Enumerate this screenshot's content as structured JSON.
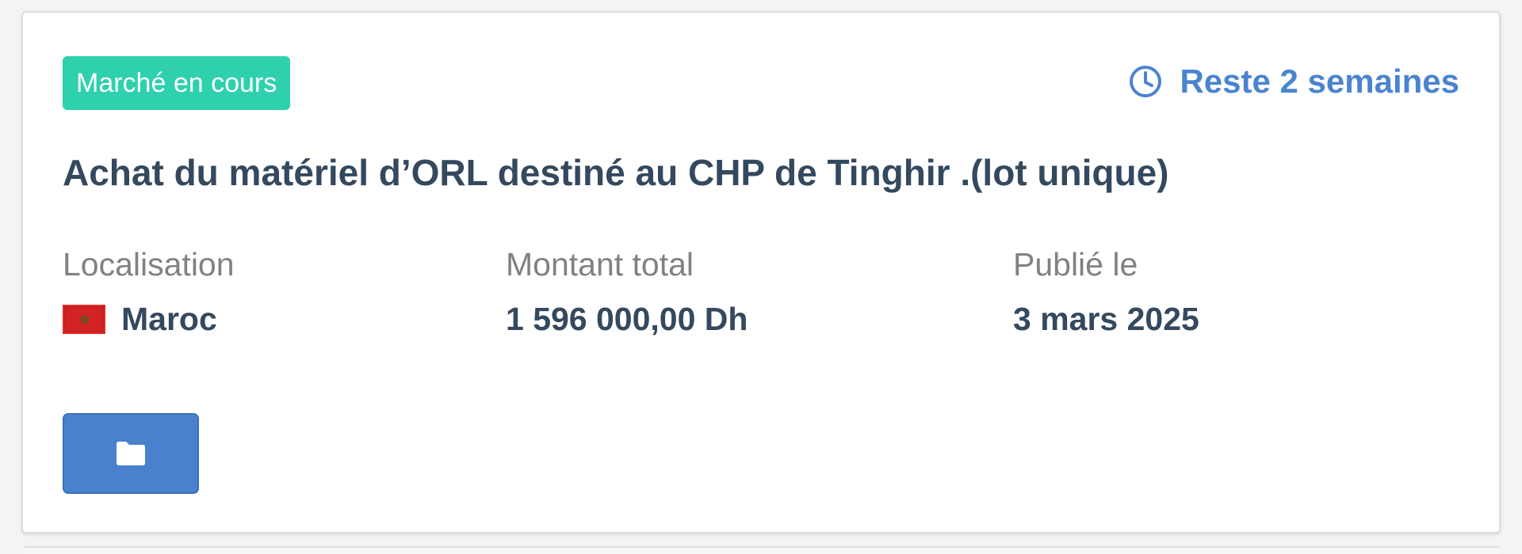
{
  "card": {
    "status_badge": "Marché en cours",
    "time_left": "Reste 2 semaines",
    "title": "Achat du matériel d’ORL destiné au CHP de Tinghir .(lot unique)",
    "details": {
      "location_label": "Localisation",
      "location_value": "Maroc",
      "amount_label": "Montant total",
      "amount_value": "1 596 000,00 Dh",
      "published_label": "Publié le",
      "published_value": "3 mars 2025"
    },
    "actions": {
      "folder_icon": "folder-icon"
    }
  },
  "colors": {
    "badge_bg": "#2fd0ad",
    "accent_blue": "#4a84cf",
    "title_text": "#34495e",
    "muted_text": "#818181",
    "button_bg": "#4a81cc"
  },
  "icons": {
    "clock": "clock-icon",
    "flag": "morocco-flag-icon",
    "folder": "folder-icon"
  }
}
